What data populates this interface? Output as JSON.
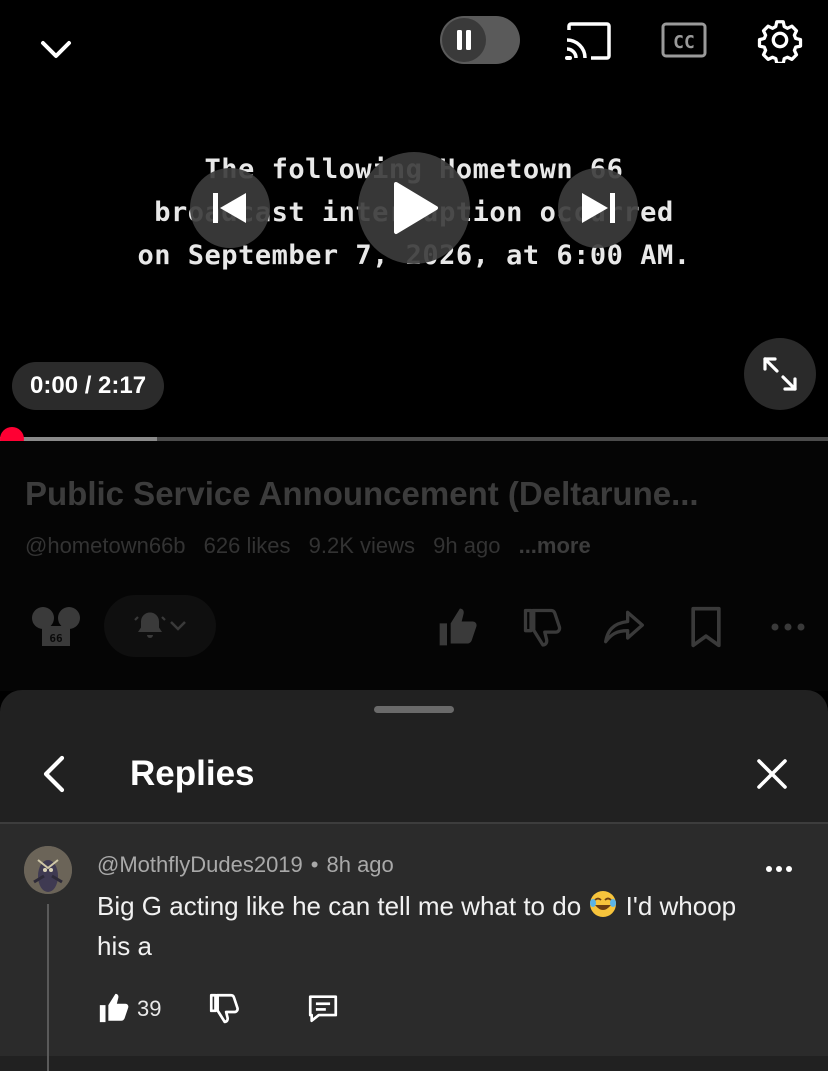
{
  "player": {
    "overlay_lines": [
      "The following Hometown 66",
      "broadcast interruption occurred",
      "on September 7, 2026, at 6:00 AM."
    ],
    "time_display": "0:00 / 2:17",
    "progress_fraction": 0,
    "buffered_fraction": 0.19,
    "icons": {
      "collapse": "chevron-down-icon",
      "autoplay": "pause-icon",
      "cast": "cast-icon",
      "captions": "cc-icon",
      "settings": "gear-icon",
      "previous": "skip-previous-icon",
      "play": "play-icon",
      "next": "skip-next-icon",
      "fullscreen": "fullscreen-icon"
    },
    "accent_color": "#ff0033"
  },
  "video": {
    "title": "Public Service Announcement (Deltarune...",
    "channel_handle": "@hometown66b",
    "likes": "626 likes",
    "views": "9.2K views",
    "age": "9h ago",
    "more_label": "...more"
  },
  "replies_panel": {
    "title": "Replies",
    "comment": {
      "author": "@MothflyDudes2019",
      "separator": "•",
      "time": "8h ago",
      "text_before_emoji": "Big G acting like he can tell me what to do",
      "emoji": "😂",
      "text_after_emoji": "I'd whoop his a",
      "like_count": "39"
    }
  }
}
